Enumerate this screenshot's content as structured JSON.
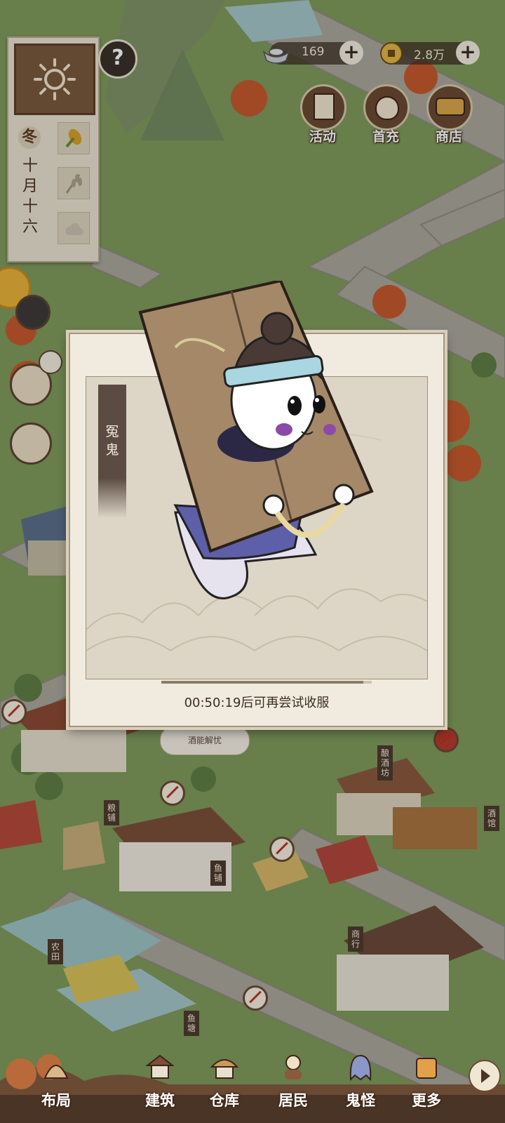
{
  "calendar": {
    "season": "冬",
    "date": "十月十六"
  },
  "help": {
    "label": "?"
  },
  "currency": [
    {
      "value": "169",
      "plus": "+"
    },
    {
      "value": "2.8万",
      "plus": "+"
    }
  ],
  "top_buttons": [
    {
      "label": "活动"
    },
    {
      "label": "首充"
    },
    {
      "label": "商店"
    }
  ],
  "modal": {
    "ghost_name": "冤鬼",
    "timer_text": "00:50:19后可再尝试收服"
  },
  "bubble": {
    "text": "酒能解忧"
  },
  "bottom_nav": [
    {
      "label": "布局"
    },
    {
      "label": "建筑"
    },
    {
      "label": "仓库"
    },
    {
      "label": "居民"
    },
    {
      "label": "鬼怪"
    },
    {
      "label": "更多"
    }
  ],
  "colors": {
    "grass": "#7f9a5c",
    "road": "#a7a59a",
    "panel_bg": "#f1ebdf",
    "accent_brown": "#6b4a33"
  }
}
